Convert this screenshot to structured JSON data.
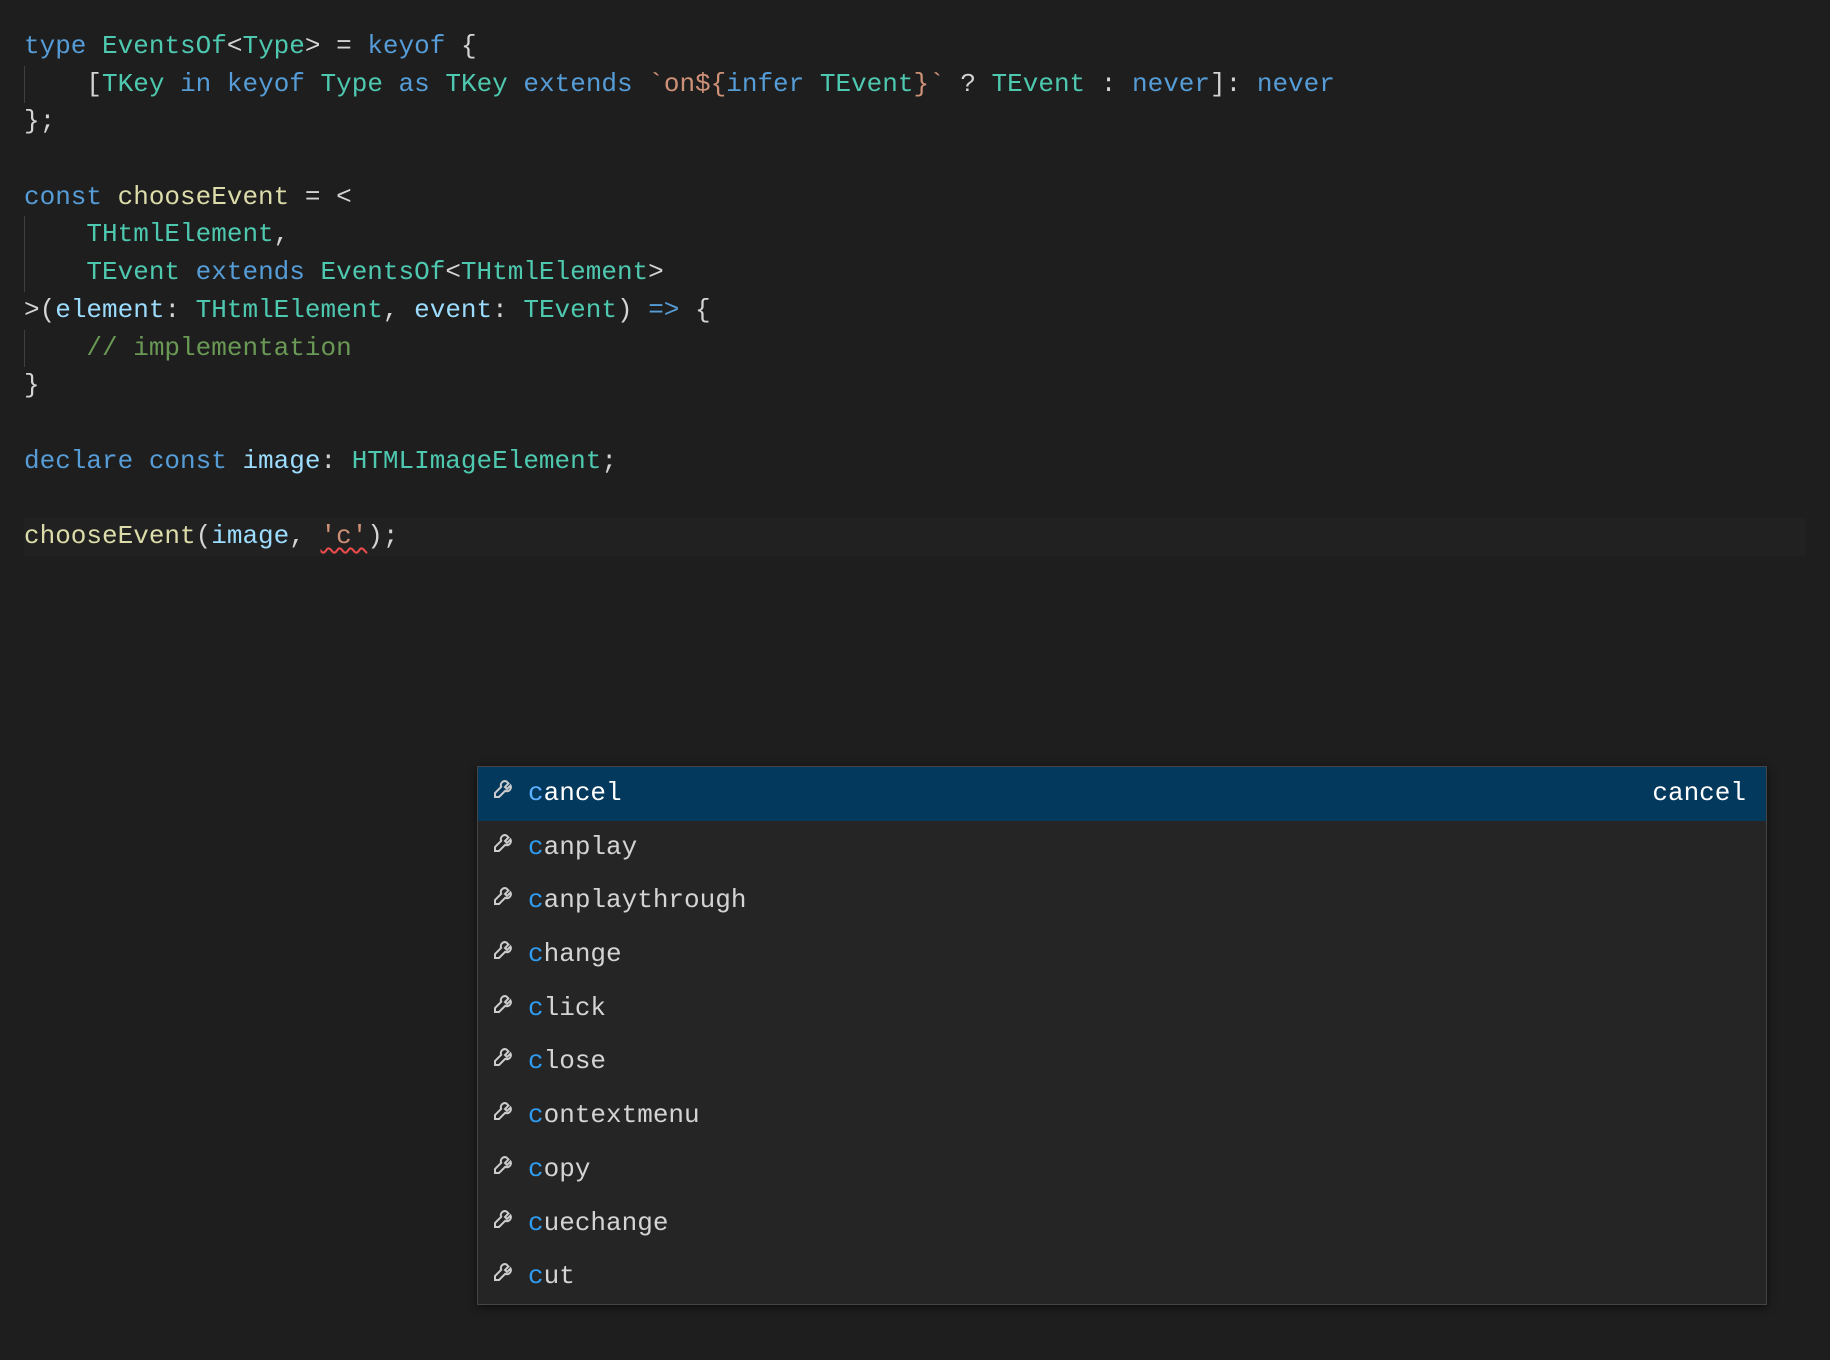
{
  "colors": {
    "background": "#1e1e1e",
    "keyword": "#569cd6",
    "type": "#4ec9b0",
    "string": "#ce9178",
    "comment": "#6a9955",
    "function": "#dcdcaa",
    "parameter": "#9cdcfe",
    "selection": "#04395e",
    "widget_bg": "#252526",
    "match_highlight": "#2f9cf0"
  },
  "code": {
    "l1": {
      "kw_type": "type",
      "name": "EventsOf",
      "tp": "Type",
      "eq": "=",
      "kw_keyof": "keyof",
      "brace": "{"
    },
    "l2": {
      "br_o": "[",
      "tkey": "TKey",
      "kw_in": "in",
      "kw_keyof": "keyof",
      "type_ref": "Type",
      "kw_as": "as",
      "tkey2": "TKey",
      "kw_ext": "extends",
      "tpl_open": "`on${",
      "kw_infer": "infer",
      "tevent": "TEvent",
      "tpl_close": "}`",
      "q": "?",
      "tevent2": "TEvent",
      "colon": ":",
      "kw_never": "never",
      "br_c": "]:",
      "kw_never2": "never"
    },
    "l3": {
      "close": "};"
    },
    "l5": {
      "kw_const": "const",
      "name": "chooseEvent",
      "eq": "=",
      "lt": "<"
    },
    "l6": {
      "tp": "THtmlElement",
      "comma": ","
    },
    "l7": {
      "tp": "TEvent",
      "kw_ext": "extends",
      "eo": "EventsOf",
      "lt": "<",
      "tp2": "THtmlElement",
      "gt": ">"
    },
    "l8": {
      "gt": ">(",
      "p1": "element",
      "c1": ":",
      "t1": "THtmlElement",
      "comma": ",",
      "p2": "event",
      "c2": ":",
      "t2": "TEvent",
      "close": ")",
      "arrow": "=>",
      "brace": "{"
    },
    "l9": {
      "comment": "// implementation"
    },
    "l10": {
      "close": "}"
    },
    "l12": {
      "kw_declare": "declare",
      "kw_const": "const",
      "name": "image",
      "colon": ":",
      "type": "HTMLImageElement",
      "semi": ";"
    },
    "l14": {
      "fn": "chooseEvent",
      "open": "(",
      "arg1": "image",
      "comma": ",",
      "str": "'c'",
      "close": ");"
    }
  },
  "intellisense": {
    "selected_index": 0,
    "selected_docs": "cancel",
    "filter_prefix": "c",
    "items": [
      {
        "icon": "wrench",
        "prefix": "c",
        "rest": "ancel"
      },
      {
        "icon": "wrench",
        "prefix": "c",
        "rest": "anplay"
      },
      {
        "icon": "wrench",
        "prefix": "c",
        "rest": "anplaythrough"
      },
      {
        "icon": "wrench",
        "prefix": "c",
        "rest": "hange"
      },
      {
        "icon": "wrench",
        "prefix": "c",
        "rest": "lick"
      },
      {
        "icon": "wrench",
        "prefix": "c",
        "rest": "lose"
      },
      {
        "icon": "wrench",
        "prefix": "c",
        "rest": "ontextmenu"
      },
      {
        "icon": "wrench",
        "prefix": "c",
        "rest": "opy"
      },
      {
        "icon": "wrench",
        "prefix": "c",
        "rest": "uechange"
      },
      {
        "icon": "wrench",
        "prefix": "c",
        "rest": "ut"
      }
    ]
  }
}
